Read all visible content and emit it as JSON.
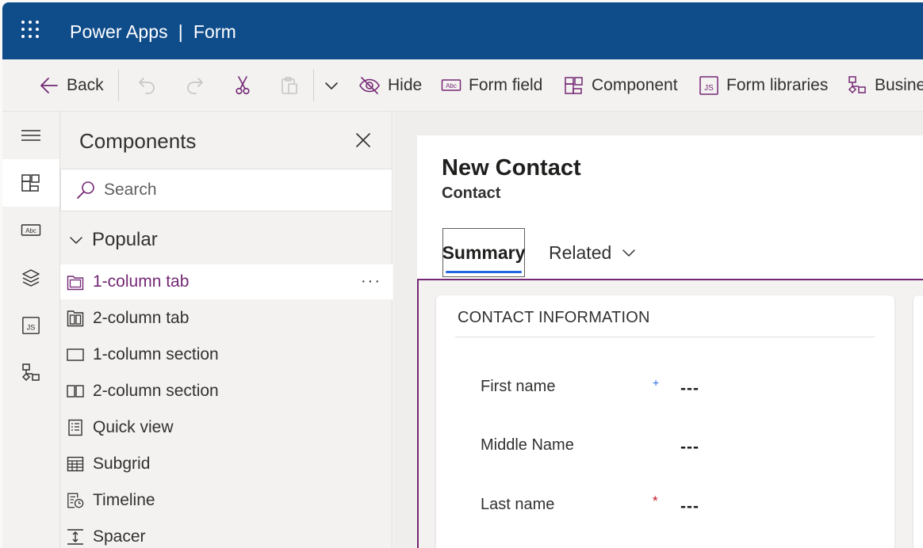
{
  "header": {
    "app_name": "Power Apps",
    "separator": "|",
    "page": "Form",
    "bg_color": "#0f4c8a"
  },
  "toolbar": {
    "back_label": "Back",
    "hide_label": "Hide",
    "form_field_label": "Form field",
    "component_label": "Component",
    "form_libraries_label": "Form libraries",
    "business_label": "Busine"
  },
  "rail": {
    "items": [
      "hamburger-icon",
      "components-icon",
      "form-field-icon",
      "layers-icon",
      "js-library-icon",
      "business-rules-icon"
    ]
  },
  "components_pane": {
    "title": "Components",
    "search_placeholder": "Search",
    "group": "Popular",
    "more": "···",
    "items": [
      {
        "label": "1-column tab",
        "icon": "one-column-tab-icon"
      },
      {
        "label": "2-column tab",
        "icon": "two-column-tab-icon"
      },
      {
        "label": "1-column section",
        "icon": "one-column-section-icon"
      },
      {
        "label": "2-column section",
        "icon": "two-column-section-icon"
      },
      {
        "label": "Quick view",
        "icon": "quick-view-icon"
      },
      {
        "label": "Subgrid",
        "icon": "subgrid-icon"
      },
      {
        "label": "Timeline",
        "icon": "timeline-icon"
      },
      {
        "label": "Spacer",
        "icon": "spacer-icon"
      }
    ]
  },
  "form": {
    "title": "New Contact",
    "entity": "Contact",
    "tabs": {
      "summary": "Summary",
      "related": "Related"
    },
    "section_title": "CONTACT INFORMATION",
    "fields": [
      {
        "label": "First name",
        "required_mark": "+",
        "value": "---"
      },
      {
        "label": "Middle Name",
        "required_mark": "",
        "value": "---"
      },
      {
        "label": "Last name",
        "required_mark": "*",
        "value": "---"
      }
    ],
    "accent_color": "#742774"
  }
}
